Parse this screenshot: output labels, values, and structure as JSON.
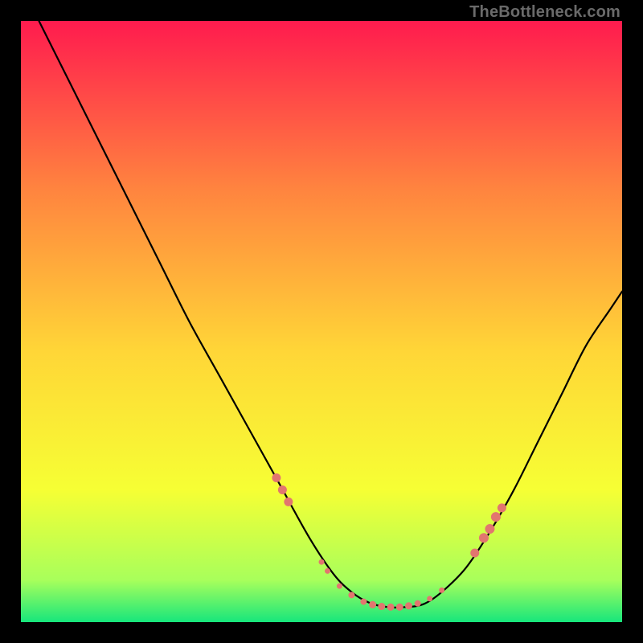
{
  "watermark": "TheBottleneck.com",
  "chart_data": {
    "type": "line",
    "title": "",
    "xlabel": "",
    "ylabel": "",
    "xlim": [
      0,
      100
    ],
    "ylim": [
      0,
      100
    ],
    "grid": false,
    "background_gradient": {
      "top": "#ff1b4e",
      "mid_upper": "#ff843f",
      "mid": "#ffd637",
      "mid_lower": "#f6ff34",
      "lower": "#a8ff5b",
      "bottom": "#17e67c"
    },
    "series": [
      {
        "name": "bottleneck-curve",
        "x": [
          3,
          8,
          13,
          18,
          23,
          28,
          33,
          38,
          43,
          48,
          52,
          55,
          58,
          61,
          64,
          67,
          70,
          74,
          78,
          82,
          86,
          90,
          94,
          98,
          100
        ],
        "y": [
          100,
          90,
          80,
          70,
          60,
          50,
          41,
          32,
          23,
          14,
          8,
          5,
          3.2,
          2.5,
          2.5,
          3,
          5,
          9,
          15,
          22,
          30,
          38,
          46,
          52,
          55
        ]
      }
    ],
    "markers": {
      "name": "highlight-dots",
      "color": "#e2766f",
      "radius_range": [
        3,
        6.5
      ],
      "points": [
        {
          "x": 42.5,
          "y": 24,
          "r": 5.5
        },
        {
          "x": 43.5,
          "y": 22,
          "r": 5.5
        },
        {
          "x": 44.5,
          "y": 20,
          "r": 5.5
        },
        {
          "x": 50,
          "y": 10,
          "r": 3.5
        },
        {
          "x": 51,
          "y": 8.5,
          "r": 3.5
        },
        {
          "x": 53,
          "y": 6,
          "r": 3.5
        },
        {
          "x": 55,
          "y": 4.5,
          "r": 4
        },
        {
          "x": 57,
          "y": 3.4,
          "r": 4
        },
        {
          "x": 58.5,
          "y": 2.9,
          "r": 4.5
        },
        {
          "x": 60,
          "y": 2.6,
          "r": 4.5
        },
        {
          "x": 61.5,
          "y": 2.5,
          "r": 4.5
        },
        {
          "x": 63,
          "y": 2.5,
          "r": 4.5
        },
        {
          "x": 64.5,
          "y": 2.7,
          "r": 4.5
        },
        {
          "x": 66,
          "y": 3.1,
          "r": 4
        },
        {
          "x": 68,
          "y": 3.9,
          "r": 3.5
        },
        {
          "x": 70,
          "y": 5.3,
          "r": 3.5
        },
        {
          "x": 75.5,
          "y": 11.5,
          "r": 5.5
        },
        {
          "x": 77,
          "y": 14,
          "r": 6
        },
        {
          "x": 78,
          "y": 15.5,
          "r": 6
        },
        {
          "x": 79,
          "y": 17.5,
          "r": 6
        },
        {
          "x": 80,
          "y": 19,
          "r": 5.5
        }
      ]
    }
  }
}
